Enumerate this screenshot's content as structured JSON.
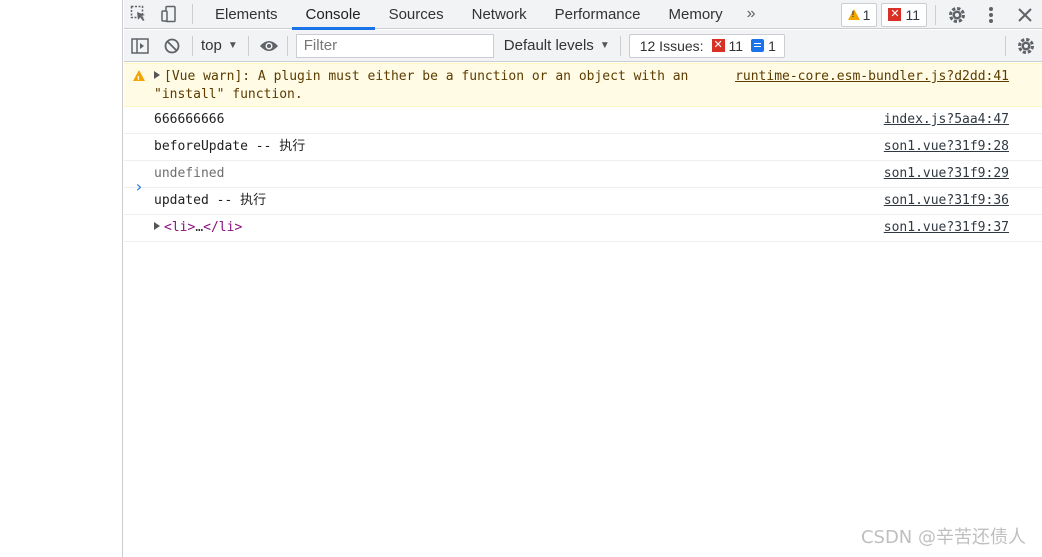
{
  "tabs": [
    {
      "label": "Elements"
    },
    {
      "label": "Console"
    },
    {
      "label": "Sources"
    },
    {
      "label": "Network"
    },
    {
      "label": "Performance"
    },
    {
      "label": "Memory"
    }
  ],
  "more_tabs_glyph": "»",
  "counts": {
    "warnings": "1",
    "errors": "11"
  },
  "toolbar": {
    "context": "top",
    "filter_placeholder": "Filter",
    "levels": "Default levels",
    "issues_label": "12 Issues:",
    "issues_errors": "11",
    "issues_messages": "1"
  },
  "messages": [
    {
      "kind": "warn",
      "text": "[Vue warn]: A plugin must either be a function or an object with an \"install\" function.",
      "source": "runtime-core.esm-bundler.js?d2dd:41"
    },
    {
      "kind": "log",
      "text": "666666666",
      "source": "index.js?5aa4:47"
    },
    {
      "kind": "log",
      "text": "beforeUpdate -- 执行",
      "source": "son1.vue?31f9:28"
    },
    {
      "kind": "undefined",
      "text": "undefined",
      "source": "son1.vue?31f9:29"
    },
    {
      "kind": "log",
      "text": "updated -- 执行",
      "source": "son1.vue?31f9:36"
    },
    {
      "kind": "element",
      "tag_open": "<li>",
      "ellipsis": "…",
      "tag_close": "</li>",
      "source": "son1.vue?31f9:37"
    }
  ],
  "prompt": "›",
  "watermark": "CSDN @辛苦还债人",
  "colors": {
    "accent": "#1a73e8",
    "warning": "#f2a600",
    "error": "#d93025",
    "warn_bg": "#fffbe5"
  }
}
